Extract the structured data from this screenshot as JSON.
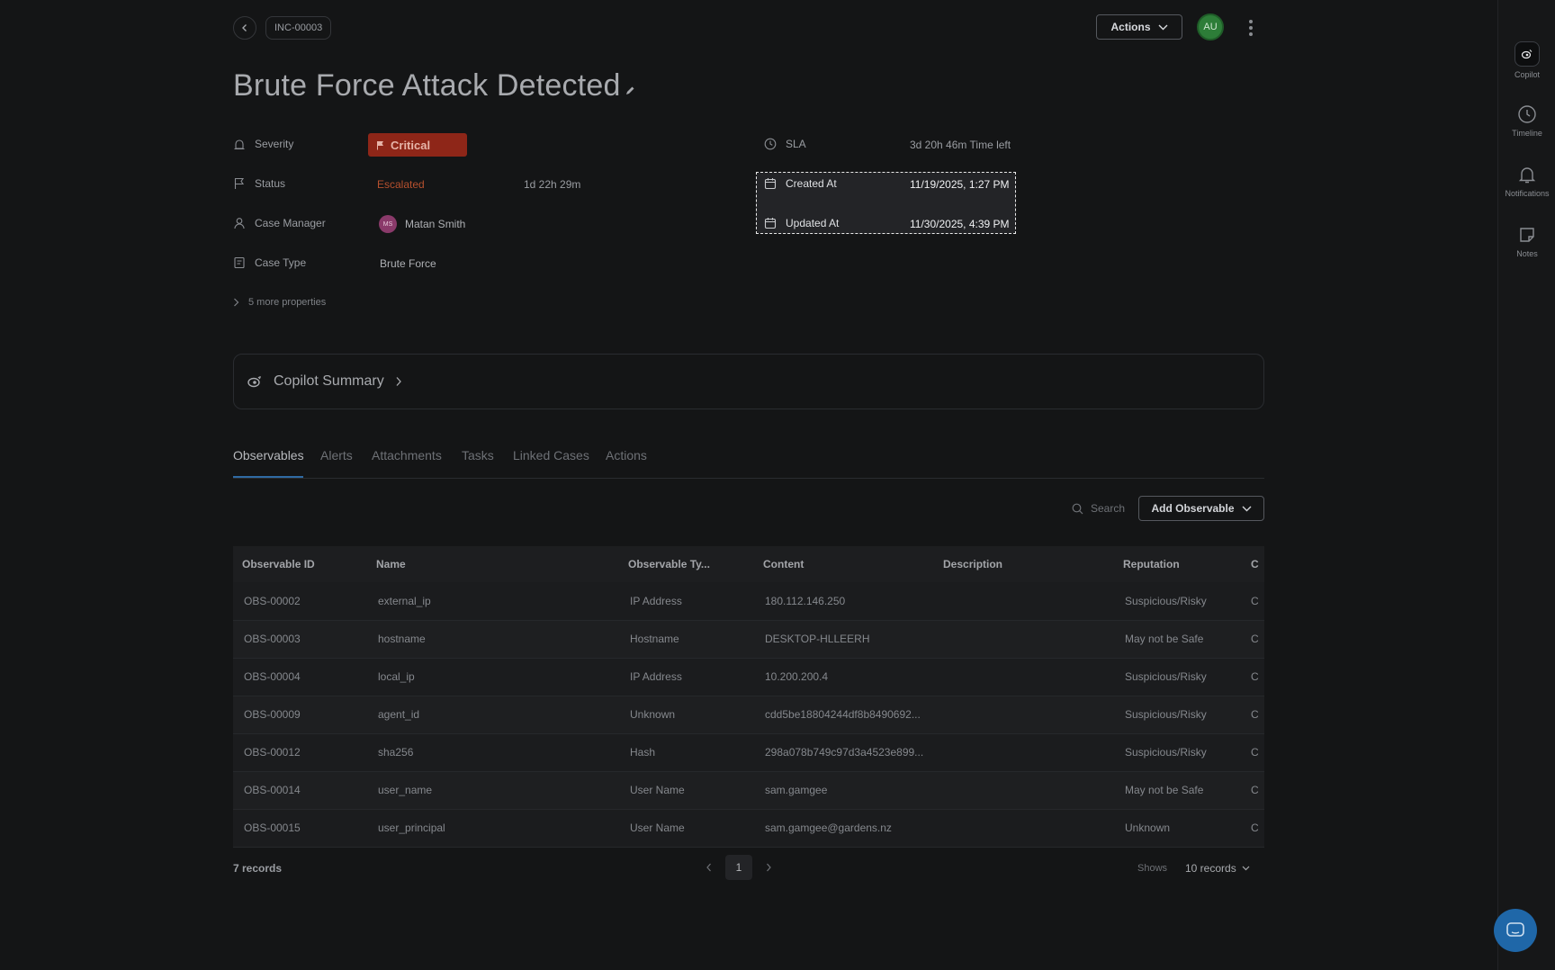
{
  "header": {
    "case_id": "INC-00003",
    "actions_label": "Actions",
    "user_initials": "AU"
  },
  "title": "Brute Force Attack Detected",
  "properties": {
    "severity": {
      "label": "Severity",
      "value": "Critical"
    },
    "status": {
      "label": "Status",
      "value": "Escalated",
      "duration": "1d 22h 29m"
    },
    "case_manager": {
      "label": "Case Manager",
      "initials": "MS",
      "value": "Matan Smith"
    },
    "case_type": {
      "label": "Case Type",
      "value": "Brute Force"
    },
    "sla": {
      "label": "SLA",
      "value": "3d 20h 46m",
      "suffix": "Time left"
    },
    "created_at": {
      "label": "Created At",
      "value": "11/19/2025, 1:27 PM"
    },
    "updated_at": {
      "label": "Updated At",
      "value": "11/30/2025, 4:39 PM"
    },
    "more": "5 more properties"
  },
  "copilot_summary": "Copilot Summary",
  "tabs": [
    "Observables",
    "Alerts",
    "Attachments",
    "Tasks",
    "Linked Cases",
    "Actions"
  ],
  "toolbar": {
    "search_placeholder": "Search",
    "add_label": "Add Observable"
  },
  "table": {
    "columns": [
      "Observable ID",
      "Name",
      "Observable Ty...",
      "Content",
      "Description",
      "Reputation",
      "C"
    ],
    "rows": [
      [
        "OBS-00002",
        "external_ip",
        "IP Address",
        "180.112.146.250",
        "",
        "Suspicious/Risky",
        "C"
      ],
      [
        "OBS-00003",
        "hostname",
        "Hostname",
        "DESKTOP-HLLEERH",
        "",
        "May not be Safe",
        "C"
      ],
      [
        "OBS-00004",
        "local_ip",
        "IP Address",
        "10.200.200.4",
        "",
        "Suspicious/Risky",
        "C"
      ],
      [
        "OBS-00009",
        "agent_id",
        "Unknown",
        "cdd5be18804244df8b8490692...",
        "",
        "Suspicious/Risky",
        "C"
      ],
      [
        "OBS-00012",
        "sha256",
        "Hash",
        "298a078b749c97d3a4523e899...",
        "",
        "Suspicious/Risky",
        "C"
      ],
      [
        "OBS-00014",
        "user_name",
        "User Name",
        "sam.gamgee",
        "",
        "May not be Safe",
        "C"
      ],
      [
        "OBS-00015",
        "user_principal",
        "User Name",
        "sam.gamgee@gardens.nz",
        "",
        "Unknown",
        "C"
      ]
    ]
  },
  "footer": {
    "records": "7 records",
    "page": "1",
    "shows": "Shows",
    "per_page": "10 records"
  },
  "rail": [
    {
      "label": "Copilot",
      "icon": "copilot-icon"
    },
    {
      "label": "Timeline",
      "icon": "clock-icon"
    },
    {
      "label": "Notifications",
      "icon": "bell-icon"
    },
    {
      "label": "Notes",
      "icon": "note-icon"
    }
  ],
  "colors": {
    "critical": "#8e2618",
    "escalated": "#b6502e",
    "tab_active": "#2f6aa3",
    "avatar": "#2d7d38"
  }
}
